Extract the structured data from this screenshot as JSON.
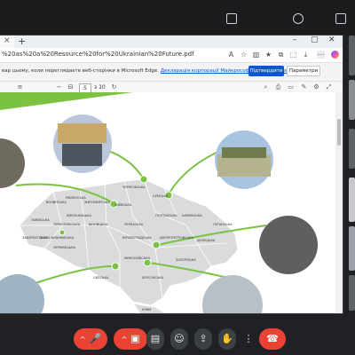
{
  "browser": {
    "tab_close": "×",
    "new_tab": "+",
    "url": "%20as%20a%20Resource%20for%20Ukrainian%20Future.pdf",
    "infobar": {
      "text": "вар цьому, коли переглядаєте веб-сторінки в Microsoft Edge.",
      "link": "Декларація корпорації Майкрософт про конфіденційність",
      "confirm": "Підтвердити",
      "params": "Параметри"
    },
    "pdf": {
      "page_current": "5",
      "page_total": "з 10"
    }
  },
  "map": {
    "region_labels": [
      "ВОЛИНСЬКА",
      "РІВНЕНСЬКА",
      "ЖИТОМИРСЬКА",
      "КИЇВСЬКА",
      "ЧЕРНІГІВСЬКА",
      "СУМСЬКА",
      "ХАРКІВСЬКА",
      "ЛУГАНСЬКА",
      "ДОНЕЦЬКА",
      "ЗАПОРІЗЬКА",
      "ХЕРСОНСЬКА",
      "МИКОЛАЇВСЬКА",
      "ОДЕСЬКА",
      "ДНІПРОПЕТРОВСЬКА",
      "ПОЛТАВСЬКА",
      "ЧЕРКАСЬКА",
      "КІРОВОГРАДСЬКА",
      "ВІННИЦЬКА",
      "ХМЕЛЬНИЦЬКА",
      "ТЕРНОПІЛЬСЬКА",
      "ЛЬВІВСЬКА",
      "ЗАКАРПАТСЬКА",
      "ІВАНО-ФРАНКІВСЬКА",
      "ЧЕРНІВЕЦЬКА",
      "КРИМ"
    ]
  },
  "colors": {
    "accent_green": "#7cc242",
    "map_fill": "#d9dbdd",
    "end_call": "#ea4335",
    "confirm_blue": "#0b57d0"
  },
  "controls": {
    "caret": "^",
    "mic_off": "🎤",
    "cam_off": "▣",
    "captions": "▤",
    "emoji": "☺",
    "present": "⇪",
    "hand": "✋",
    "more": "⋮",
    "end_call": "☎"
  }
}
